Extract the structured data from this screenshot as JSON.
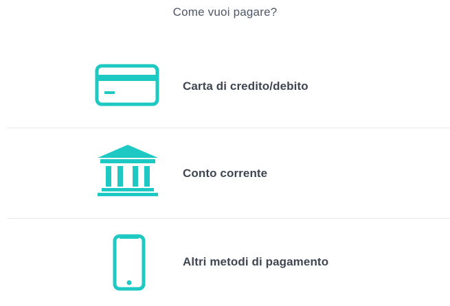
{
  "question": "Come vuoi pagare?",
  "accent_color": "#1ec9c3",
  "options": [
    {
      "label": "Carta di credito/debito",
      "icon": "credit-card-icon"
    },
    {
      "label": "Conto corrente",
      "icon": "bank-icon"
    },
    {
      "label": "Altri metodi di pagamento",
      "icon": "smartphone-icon"
    }
  ]
}
